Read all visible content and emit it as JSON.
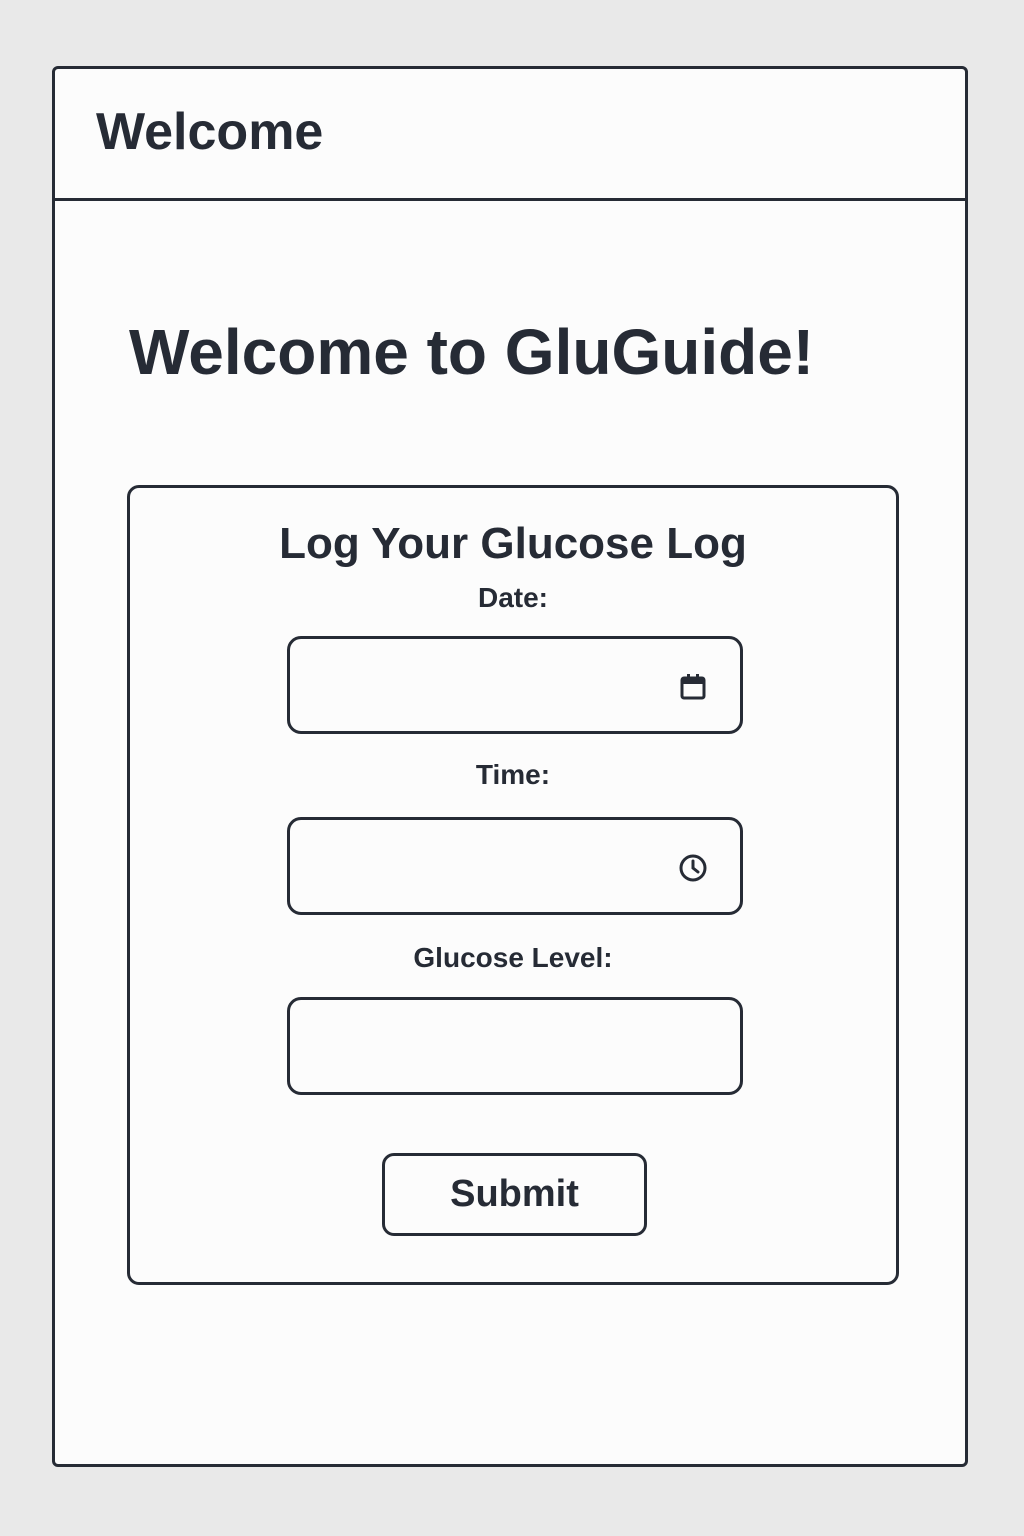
{
  "header": {
    "title": "Welcome"
  },
  "main": {
    "heading": "Welcome to GluGuide!"
  },
  "form": {
    "title": "Log Your Glucose Log",
    "date": {
      "label": "Date:",
      "value": "",
      "icon": "calendar-icon"
    },
    "time": {
      "label": "Time:",
      "value": "",
      "icon": "clock-icon"
    },
    "glucose": {
      "label": "Glucose Level:",
      "value": ""
    },
    "submit_label": "Submit"
  },
  "colors": {
    "ink": "#262b35",
    "surface": "#fcfcfc",
    "backdrop": "#e9e9e9"
  }
}
